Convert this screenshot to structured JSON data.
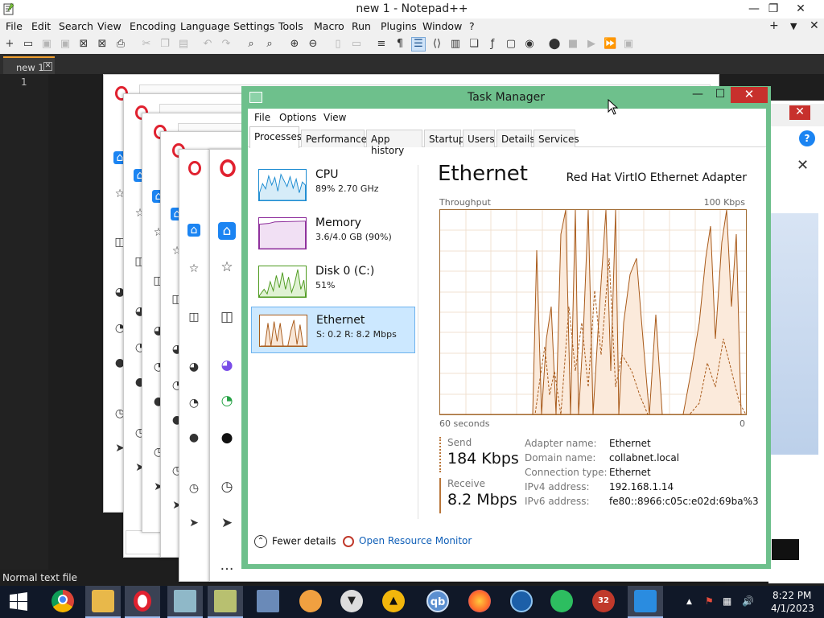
{
  "notepad": {
    "title": "new 1 - Notepad++",
    "menu": [
      "File",
      "Edit",
      "Search",
      "View",
      "Encoding",
      "Language",
      "Settings",
      "Tools",
      "Macro",
      "Run",
      "Plugins",
      "Window",
      "?"
    ],
    "menu_right": {
      "add": "+",
      "dropdown": "▼",
      "close": "✕"
    },
    "window_buttons": {
      "minimize": "—",
      "maximize": "❐",
      "close": "✕"
    },
    "tab_label": "new 1",
    "tab_close": "✕",
    "line_number": "1",
    "status": "Normal text file",
    "accent_color": "#f0a030"
  },
  "task_manager": {
    "title": "Task Manager",
    "menu": [
      "File",
      "Options",
      "View"
    ],
    "tabs": [
      "Processes",
      "Performance",
      "App history",
      "Startup",
      "Users",
      "Details",
      "Services"
    ],
    "active_tab": "Processes",
    "resources": [
      {
        "name": "CPU",
        "value": "89% 2.70 GHz",
        "color": "#1b8bd1"
      },
      {
        "name": "Memory",
        "value": "3.6/4.0 GB (90%)",
        "color": "#8c2b9a"
      },
      {
        "name": "Disk 0 (C:)",
        "value": "51%",
        "color": "#4d9a1e"
      },
      {
        "name": "Ethernet",
        "value": "S: 0.2 R: 8.2 Mbps",
        "color": "#a85a1a"
      }
    ],
    "selected_resource": "Ethernet",
    "detail": {
      "title": "Ethernet",
      "adapter": "Red Hat VirtIO Ethernet Adapter",
      "throughput_label": "Throughput",
      "max_label": "100 Kbps",
      "time_label": "60 seconds",
      "zero_label": "0",
      "send_label": "Send",
      "send_value": "184 Kbps",
      "receive_label": "Receive",
      "receive_value": "8.2 Mbps",
      "properties": [
        {
          "key": "Adapter name:",
          "value": "Ethernet"
        },
        {
          "key": "Domain name:",
          "value": "collabnet.local"
        },
        {
          "key": "Connection type:",
          "value": "Ethernet"
        },
        {
          "key": "IPv4 address:",
          "value": "192.168.1.14"
        },
        {
          "key": "IPv6 address:",
          "value": "fe80::8966:c05c:e02d:69ba%3"
        }
      ]
    },
    "footer": {
      "fewer_details": "Fewer details",
      "open_resource_monitor": "Open Resource Monitor"
    },
    "window_buttons": {
      "minimize": "—",
      "maximize": "☐",
      "close": "✕"
    },
    "frame_color": "#6ec08c"
  },
  "taskbar": {
    "time": "8:22 PM",
    "date": "4/1/2023",
    "apps": [
      "chrome",
      "file-explorer",
      "opera",
      "task-manager",
      "notepad-plus-plus",
      "network-setup",
      "eye-app",
      "cat-app",
      "warning-app",
      "qbittorrent",
      "firefox",
      "edge-app",
      "evernote",
      "bug-app",
      "vscode"
    ],
    "bug_badge": "32",
    "qb_label": "qb",
    "tray_up": "▲",
    "tray_sound": "🔊"
  },
  "browser": {
    "right_close": "✕",
    "help": "?",
    "big_close": "✕"
  }
}
